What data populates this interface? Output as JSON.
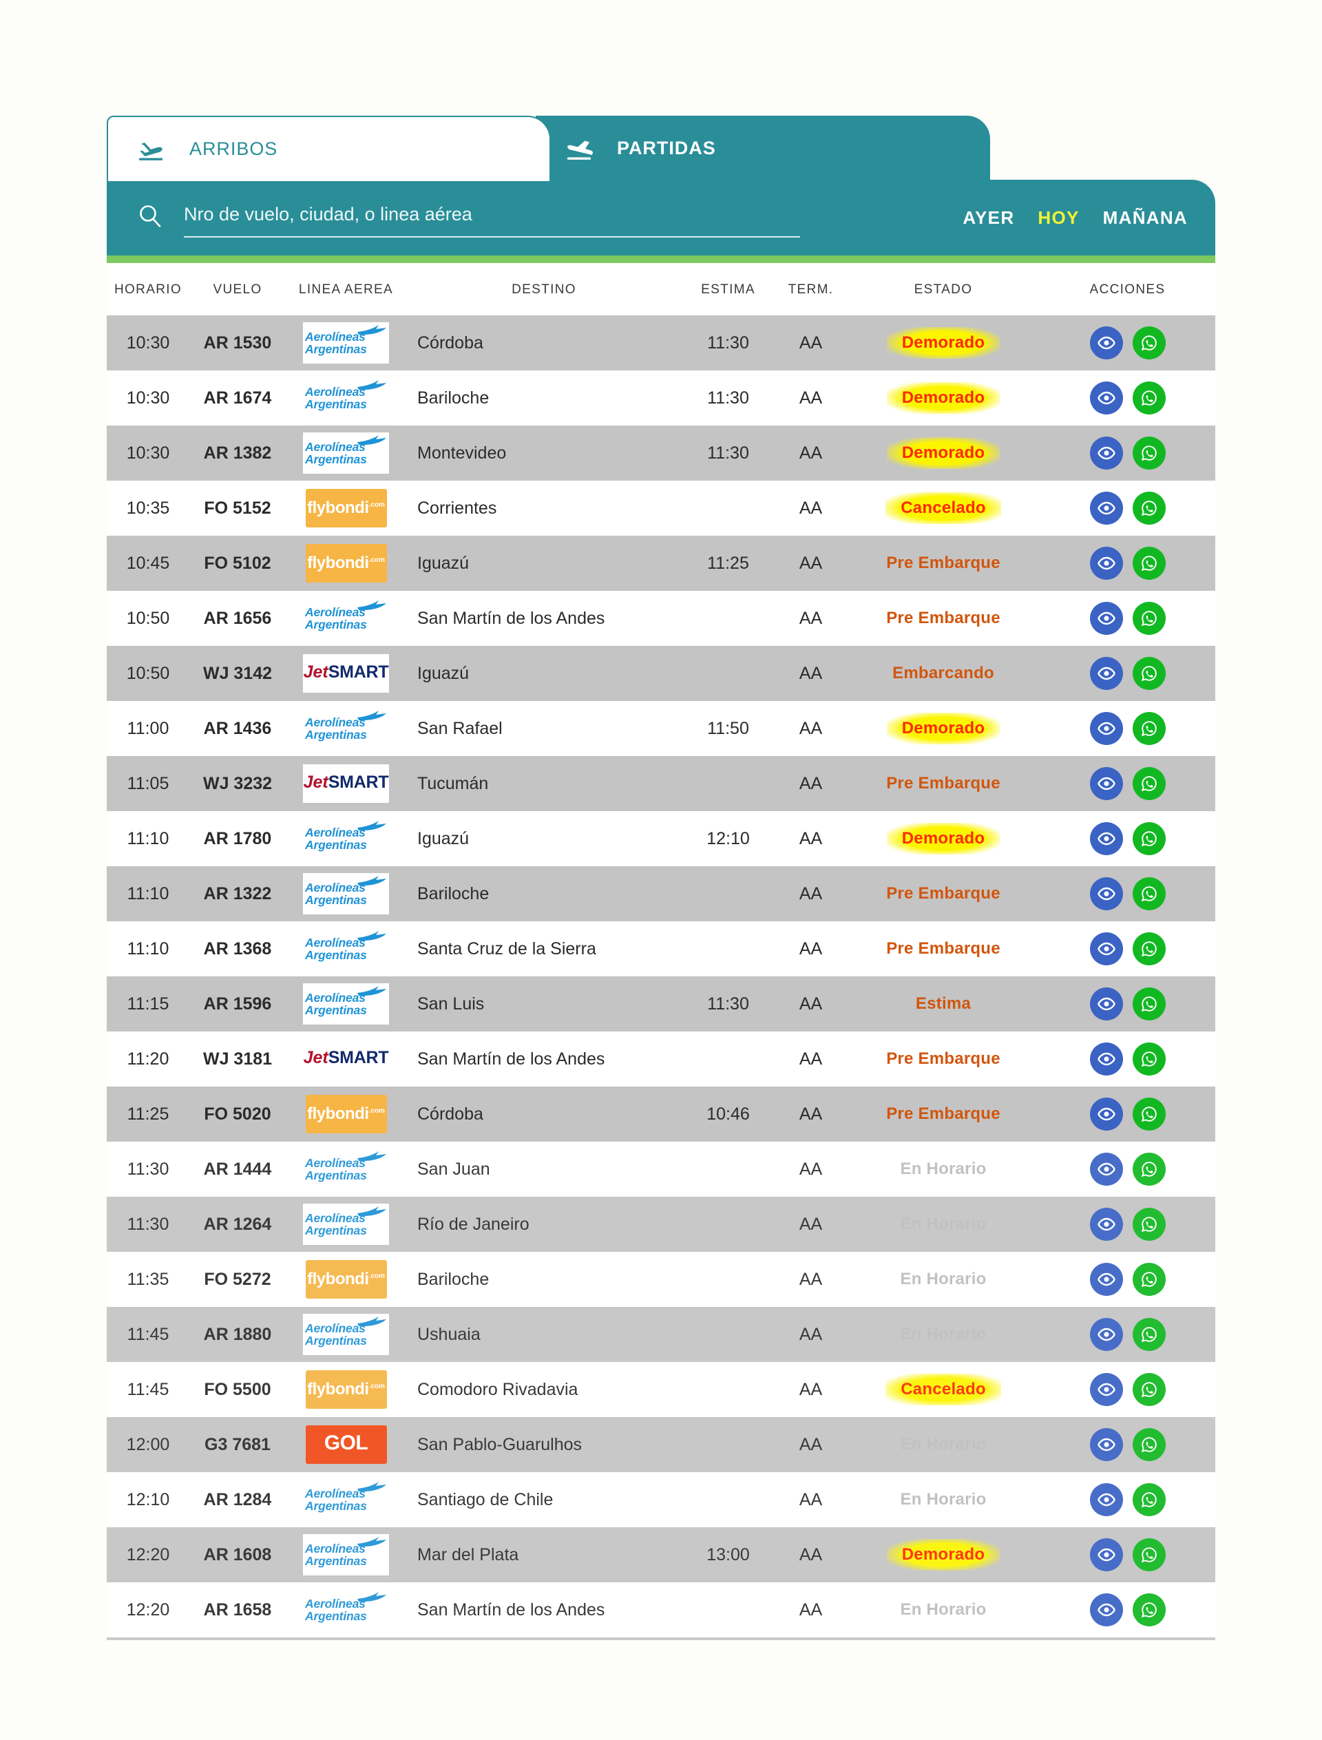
{
  "tabs": [
    {
      "id": "arribos",
      "label": "ARRIBOS",
      "icon": "plane-landing-icon",
      "active": false
    },
    {
      "id": "partidas",
      "label": "PARTIDAS",
      "icon": "plane-takeoff-icon",
      "active": true
    }
  ],
  "search": {
    "icon": "search-icon",
    "placeholder": "Nro de vuelo, ciudad, o linea aérea",
    "value": ""
  },
  "day_nav": [
    {
      "id": "ayer",
      "label": "AYER",
      "active": false
    },
    {
      "id": "hoy",
      "label": "HOY",
      "active": true
    },
    {
      "id": "manana",
      "label": "MAÑANA",
      "active": false
    }
  ],
  "colors": {
    "teal": "#2a8e98",
    "green_accent": "#7dc860",
    "highlight_yellow": "#fcf500",
    "status_red": "#ff2a00",
    "status_orange": "#d2560d",
    "status_grey": "#bdbdbd",
    "row_alt": "#c4c4c4",
    "view_blue": "#3b63c4",
    "whatsapp_green": "#12b822"
  },
  "table": {
    "headers": [
      "HORARIO",
      "VUELO",
      "LINEA AEREA",
      "DESTINO",
      "ESTIMA",
      "TERM.",
      "ESTADO",
      "ACCIONES"
    ],
    "actions": {
      "view": "eye-icon",
      "whatsapp": "whatsapp-icon"
    },
    "rows": [
      {
        "horario": "10:30",
        "vuelo": "AR 1530",
        "airline": "aerolineas",
        "destino": "Córdoba",
        "estima": "11:30",
        "term": "AA",
        "estado": "Demorado",
        "estado_type": "demorado"
      },
      {
        "horario": "10:30",
        "vuelo": "AR 1674",
        "airline": "aerolineas",
        "destino": "Bariloche",
        "estima": "11:30",
        "term": "AA",
        "estado": "Demorado",
        "estado_type": "demorado"
      },
      {
        "horario": "10:30",
        "vuelo": "AR 1382",
        "airline": "aerolineas",
        "destino": "Montevideo",
        "estima": "11:30",
        "term": "AA",
        "estado": "Demorado",
        "estado_type": "demorado"
      },
      {
        "horario": "10:35",
        "vuelo": "FO 5152",
        "airline": "flybondi",
        "destino": "Corrientes",
        "estima": "",
        "term": "AA",
        "estado": "Cancelado",
        "estado_type": "cancelado"
      },
      {
        "horario": "10:45",
        "vuelo": "FO 5102",
        "airline": "flybondi",
        "destino": "Iguazú",
        "estima": "11:25",
        "term": "AA",
        "estado": "Pre Embarque",
        "estado_type": "preembarque"
      },
      {
        "horario": "10:50",
        "vuelo": "AR 1656",
        "airline": "aerolineas",
        "destino": "San Martín de los Andes",
        "estima": "",
        "term": "AA",
        "estado": "Pre Embarque",
        "estado_type": "preembarque"
      },
      {
        "horario": "10:50",
        "vuelo": "WJ 3142",
        "airline": "jetsmart",
        "destino": "Iguazú",
        "estima": "",
        "term": "AA",
        "estado": "Embarcando",
        "estado_type": "embarcando"
      },
      {
        "horario": "11:00",
        "vuelo": "AR 1436",
        "airline": "aerolineas",
        "destino": "San Rafael",
        "estima": "11:50",
        "term": "AA",
        "estado": "Demorado",
        "estado_type": "demorado"
      },
      {
        "horario": "11:05",
        "vuelo": "WJ 3232",
        "airline": "jetsmart",
        "destino": "Tucumán",
        "estima": "",
        "term": "AA",
        "estado": "Pre Embarque",
        "estado_type": "preembarque"
      },
      {
        "horario": "11:10",
        "vuelo": "AR 1780",
        "airline": "aerolineas",
        "destino": "Iguazú",
        "estima": "12:10",
        "term": "AA",
        "estado": "Demorado",
        "estado_type": "demorado"
      },
      {
        "horario": "11:10",
        "vuelo": "AR 1322",
        "airline": "aerolineas",
        "destino": "Bariloche",
        "estima": "",
        "term": "AA",
        "estado": "Pre Embarque",
        "estado_type": "preembarque"
      },
      {
        "horario": "11:10",
        "vuelo": "AR 1368",
        "airline": "aerolineas",
        "destino": "Santa Cruz de la Sierra",
        "estima": "",
        "term": "AA",
        "estado": "Pre Embarque",
        "estado_type": "preembarque"
      },
      {
        "horario": "11:15",
        "vuelo": "AR 1596",
        "airline": "aerolineas",
        "destino": "San Luis",
        "estima": "11:30",
        "term": "AA",
        "estado": "Estima",
        "estado_type": "estima"
      },
      {
        "horario": "11:20",
        "vuelo": "WJ 3181",
        "airline": "jetsmart",
        "destino": "San Martín de los Andes",
        "estima": "",
        "term": "AA",
        "estado": "Pre Embarque",
        "estado_type": "preembarque"
      },
      {
        "horario": "11:25",
        "vuelo": "FO 5020",
        "airline": "flybondi",
        "destino": "Córdoba",
        "estima": "10:46",
        "term": "AA",
        "estado": "Pre Embarque",
        "estado_type": "preembarque"
      },
      {
        "horario": "11:30",
        "vuelo": "AR 1444",
        "airline": "aerolineas",
        "destino": "San Juan",
        "estima": "",
        "term": "AA",
        "estado": "En Horario",
        "estado_type": "enhorario"
      },
      {
        "horario": "11:30",
        "vuelo": "AR 1264",
        "airline": "aerolineas",
        "destino": "Río de Janeiro",
        "estima": "",
        "term": "AA",
        "estado": "En Horario",
        "estado_type": "enhorario"
      },
      {
        "horario": "11:35",
        "vuelo": "FO 5272",
        "airline": "flybondi",
        "destino": "Bariloche",
        "estima": "",
        "term": "AA",
        "estado": "En Horario",
        "estado_type": "enhorario"
      },
      {
        "horario": "11:45",
        "vuelo": "AR 1880",
        "airline": "aerolineas",
        "destino": "Ushuaia",
        "estima": "",
        "term": "AA",
        "estado": "En Horario",
        "estado_type": "enhorario"
      },
      {
        "horario": "11:45",
        "vuelo": "FO 5500",
        "airline": "flybondi",
        "destino": "Comodoro Rivadavia",
        "estima": "",
        "term": "AA",
        "estado": "Cancelado",
        "estado_type": "cancelado"
      },
      {
        "horario": "12:00",
        "vuelo": "G3 7681",
        "airline": "gol",
        "destino": "San Pablo-Guarulhos",
        "estima": "",
        "term": "AA",
        "estado": "En Horario",
        "estado_type": "enhorario"
      },
      {
        "horario": "12:10",
        "vuelo": "AR 1284",
        "airline": "aerolineas",
        "destino": "Santiago de Chile",
        "estima": "",
        "term": "AA",
        "estado": "En Horario",
        "estado_type": "enhorario"
      },
      {
        "horario": "12:20",
        "vuelo": "AR 1608",
        "airline": "aerolineas",
        "destino": "Mar del Plata",
        "estima": "13:00",
        "term": "AA",
        "estado": "Demorado",
        "estado_type": "demorado"
      },
      {
        "horario": "12:20",
        "vuelo": "AR 1658",
        "airline": "aerolineas",
        "destino": "San Martín de los Andes",
        "estima": "",
        "term": "AA",
        "estado": "En Horario",
        "estado_type": "enhorario"
      }
    ]
  },
  "airline_logos": {
    "aerolineas": {
      "name": "Aerolíneas Argentinas",
      "line1": "Aerolíneas",
      "line2": "Argentinas"
    },
    "flybondi": {
      "name": "flybondi",
      "text": "flybondi",
      ".com": ".com"
    },
    "jetsmart": {
      "name": "JetSMART",
      "part1": "Jet",
      "part2": "SMART"
    },
    "gol": {
      "name": "GOL",
      "text": "GOL"
    }
  }
}
